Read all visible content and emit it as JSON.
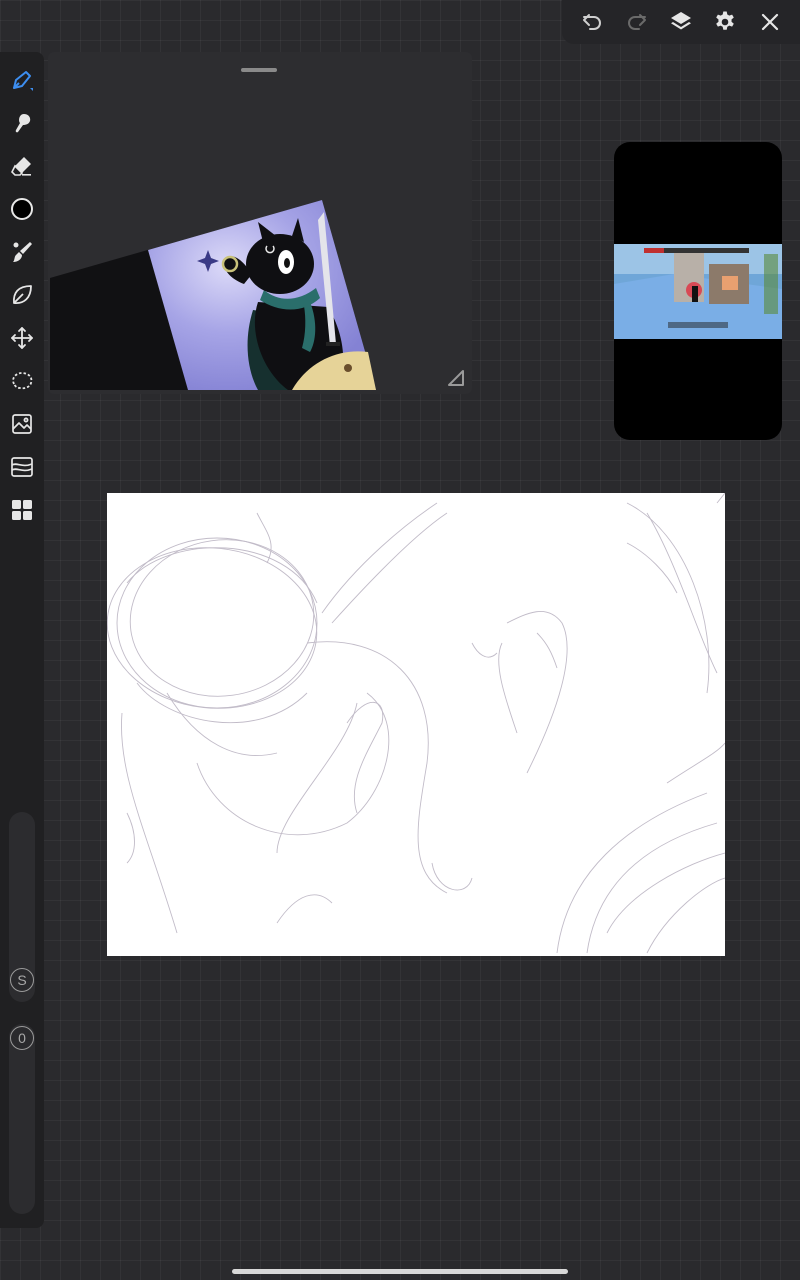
{
  "toolbar": {
    "items": [
      {
        "icon": "undo-icon"
      },
      {
        "icon": "redo-icon"
      },
      {
        "icon": "layers-icon"
      },
      {
        "icon": "settings-gear-icon"
      },
      {
        "icon": "close-icon"
      }
    ]
  },
  "sidebar": {
    "tools": [
      {
        "icon": "brush-pen-icon",
        "active": true
      },
      {
        "icon": "smudge-icon"
      },
      {
        "icon": "eraser-icon"
      },
      {
        "icon": "color-swatch",
        "color": "#000000"
      },
      {
        "icon": "brush-settings-icon"
      },
      {
        "icon": "leaf-shape-icon"
      },
      {
        "icon": "move-transform-icon"
      },
      {
        "icon": "lasso-select-icon"
      },
      {
        "icon": "image-import-icon"
      },
      {
        "icon": "layer-adjust-icon"
      },
      {
        "icon": "gallery-grid-icon"
      }
    ],
    "size_badge": "S",
    "opacity_badge": "0"
  },
  "colors": {
    "accent": "#3d8ef0",
    "background": "#2a2a2d",
    "sidebar": "#202022",
    "reference_purple": "#8f8ddc"
  },
  "reference_window": {
    "icon": "reference-image"
  },
  "phone_overlay": {
    "icon": "screen-recording-preview"
  }
}
